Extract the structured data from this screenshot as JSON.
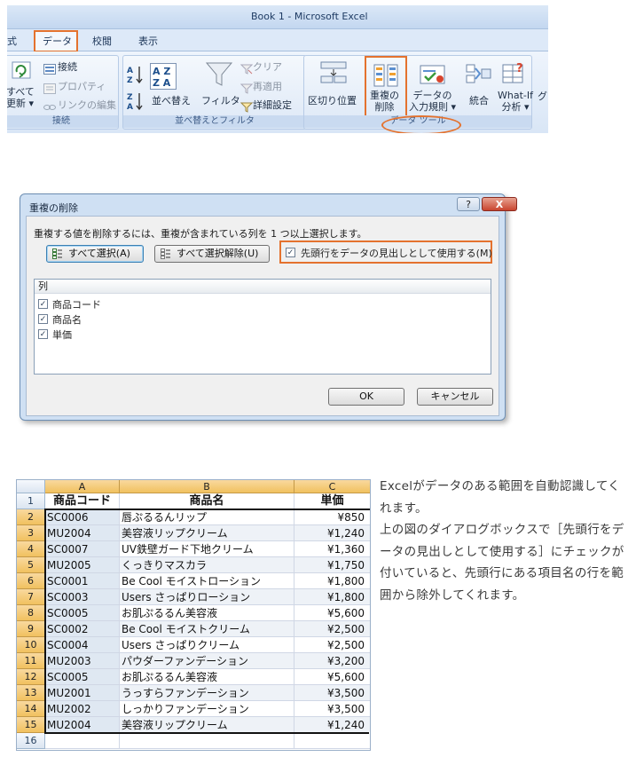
{
  "ribbon": {
    "window_title": "Book 1 - Microsoft Excel",
    "tabs": [
      "式",
      "データ",
      "校閲",
      "表示"
    ],
    "active_tab": "データ",
    "groups": {
      "connections": {
        "label": "接続",
        "refresh_all": [
          "すべて",
          "更新"
        ],
        "connections": "接続",
        "properties": "プロパティ",
        "edit_links": "リンクの編集"
      },
      "sort_filter": {
        "label": "並べ替えとフィルタ",
        "sort": "並べ替え",
        "filter": "フィルタ",
        "clear": "クリア",
        "reapply": "再適用",
        "advanced": "詳細設定"
      },
      "data_tools": {
        "label": "データ ツール",
        "text_to_columns": "区切り位置",
        "remove_duplicates": [
          "重複の",
          "削除"
        ],
        "data_validation": [
          "データの",
          "入力規則"
        ],
        "consolidate": "統合",
        "what_if": [
          "What-If",
          "分析"
        ]
      },
      "partial_next": "グ"
    },
    "highlight_color": "#e4722e"
  },
  "dialog": {
    "title": "重複の削除",
    "help": "?",
    "close": "X",
    "instruction": "重複する値を削除するには、重複が含まれている列を 1 つ以上選択します。",
    "select_all": "すべて選択(A)",
    "unselect_all": "すべて選択解除(U)",
    "header_checkbox_label": "先頭行をデータの見出しとして使用する(M)",
    "header_checked": true,
    "columns_header": "列",
    "columns": [
      {
        "label": "商品コード",
        "checked": true
      },
      {
        "label": "商品名",
        "checked": true
      },
      {
        "label": "単価",
        "checked": true
      }
    ],
    "ok": "OK",
    "cancel": "キャンセル"
  },
  "sheet": {
    "col_headers": [
      "A",
      "B",
      "C"
    ],
    "header_row": [
      "商品コード",
      "商品名",
      "単価"
    ],
    "rows": [
      [
        "SC0006",
        "唇ぷるるんリップ",
        "¥850"
      ],
      [
        "MU2004",
        "美容液リップクリーム",
        "¥1,240"
      ],
      [
        "SC0007",
        "UV鉄壁ガード下地クリーム",
        "¥1,360"
      ],
      [
        "MU2005",
        "くっきりマスカラ",
        "¥1,750"
      ],
      [
        "SC0001",
        "Be Cool モイストローション",
        "¥1,800"
      ],
      [
        "SC0003",
        "Users さっぱりローション",
        "¥1,800"
      ],
      [
        "SC0005",
        "お肌ぷるるん美容液",
        "¥5,600"
      ],
      [
        "SC0002",
        "Be Cool モイストクリーム",
        "¥2,500"
      ],
      [
        "SC0004",
        "Users さっぱりクリーム",
        "¥2,500"
      ],
      [
        "MU2003",
        "パウダーファンデーション",
        "¥3,200"
      ],
      [
        "SC0005",
        "お肌ぷるるん美容液",
        "¥5,600"
      ],
      [
        "MU2001",
        "うっすらファンデーション",
        "¥3,500"
      ],
      [
        "MU2002",
        "しっかりファンデーション",
        "¥3,500"
      ],
      [
        "MU2004",
        "美容液リップクリーム",
        "¥1,240"
      ]
    ],
    "last_row_number": "16"
  },
  "explanation": [
    "Excelがデータのある範囲を自動認識してくれます。",
    "上の図のダイアログボックスで［先頭行をデータの見出しとして使用する］にチェックが付いていると、先頭行にある項目名の行を範囲から除外してくれます。"
  ]
}
